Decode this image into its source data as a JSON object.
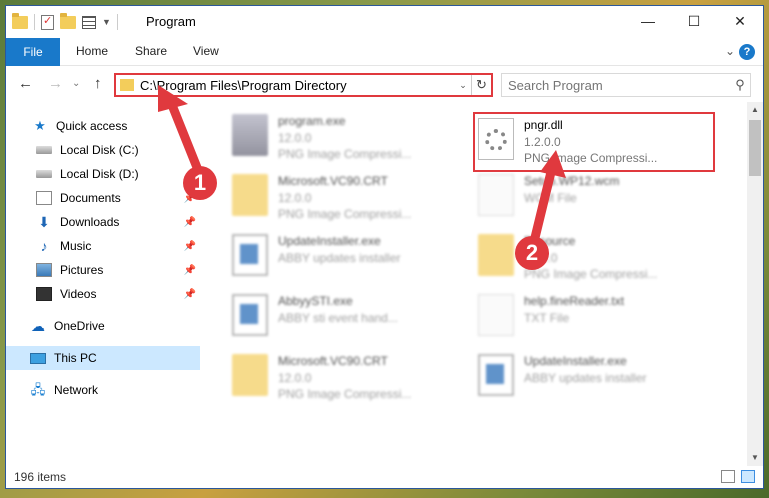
{
  "window": {
    "title": "Program",
    "controls": {
      "minimize": "—",
      "maximize": "☐",
      "close": "✕"
    }
  },
  "ribbon": {
    "tabs": [
      "File",
      "Home",
      "Share",
      "View"
    ],
    "chevron": "⌄",
    "help": "?"
  },
  "nav": {
    "back": "←",
    "forward": "→",
    "recent": "⌄",
    "up": "↑",
    "address": "C:\\Program Files\\Program Directory",
    "address_dropdown": "⌄",
    "refresh": "↻",
    "search_placeholder": "Search Program",
    "search_icon": "⚲"
  },
  "sidebar": {
    "items": [
      {
        "label": "Quick access",
        "icon": "star-icon",
        "pinned": false
      },
      {
        "label": "Local Disk (C:)",
        "icon": "disk-icon",
        "pinned": false
      },
      {
        "label": "Local Disk (D:)",
        "icon": "disk-icon",
        "pinned": false
      },
      {
        "label": "Documents",
        "icon": "documents-icon",
        "pinned": true
      },
      {
        "label": "Downloads",
        "icon": "download-icon",
        "pinned": true
      },
      {
        "label": "Music",
        "icon": "music-icon",
        "pinned": true
      },
      {
        "label": "Pictures",
        "icon": "pictures-icon",
        "pinned": true
      },
      {
        "label": "Videos",
        "icon": "videos-icon",
        "pinned": true
      },
      {
        "label": "OneDrive",
        "icon": "cloud-icon",
        "pinned": false
      },
      {
        "label": "This PC",
        "icon": "pc-icon",
        "pinned": false
      },
      {
        "label": "Network",
        "icon": "network-icon",
        "pinned": false
      }
    ],
    "pin_glyph": "📌"
  },
  "files": [
    {
      "name": "program.exe",
      "sub1": "12.0.0",
      "sub2": "PNG Image Compressi...",
      "icon": "exe-icon",
      "blurred": true
    },
    {
      "name": "pngr.dll",
      "sub1": "1.2.0.0",
      "sub2": "PNG Image Compressi...",
      "icon": "dll-gear-icon",
      "blurred": false
    },
    {
      "name": "Microsoft.VC90.CRT",
      "sub1": "12.0.0",
      "sub2": "PNG Image Compressi...",
      "icon": "folder-icon",
      "blurred": true
    },
    {
      "name": "Setup.WP12.wcm",
      "sub1": "WCM File",
      "sub2": "",
      "icon": "document-icon",
      "blurred": true
    },
    {
      "name": "UpdateInstaller.exe",
      "sub1": "ABBY updates installer",
      "sub2": "",
      "icon": "installer-icon",
      "blurred": true
    },
    {
      "name": "Resource",
      "sub1": "12.0.0",
      "sub2": "PNG Image Compressi...",
      "icon": "folder-icon",
      "blurred": true
    },
    {
      "name": "AbbyySTI.exe",
      "sub1": "ABBY sti event hand...",
      "sub2": "",
      "icon": "installer-icon",
      "blurred": true
    },
    {
      "name": "help.fineReader.txt",
      "sub1": "TXT File",
      "sub2": "",
      "icon": "document-icon",
      "blurred": true
    },
    {
      "name": "Microsoft.VC90.CRT",
      "sub1": "12.0.0",
      "sub2": "PNG Image Compressi...",
      "icon": "folder-icon",
      "blurred": true
    },
    {
      "name": "UpdateInstaller.exe",
      "sub1": "ABBY updates installer",
      "sub2": "",
      "icon": "installer-icon",
      "blurred": true
    }
  ],
  "status": {
    "items": "196 items"
  },
  "annotations": {
    "badge1": "1",
    "badge2": "2"
  },
  "colors": {
    "accent": "#1979ca",
    "highlight_red": "#e0393e",
    "selected": "#cce8ff"
  }
}
